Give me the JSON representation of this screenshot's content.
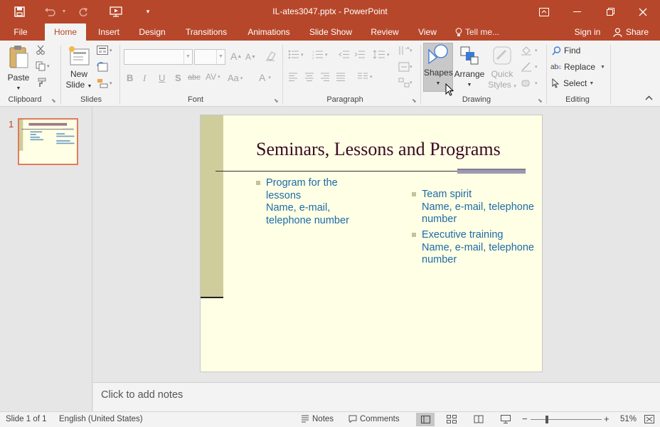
{
  "window": {
    "title": "IL-ates3047.pptx - PowerPoint"
  },
  "ribbon_tabs": [
    "File",
    "Home",
    "Insert",
    "Design",
    "Transitions",
    "Animations",
    "Slide Show",
    "Review",
    "View"
  ],
  "tell_me": "Tell me...",
  "sign_in": "Sign in",
  "share": "Share",
  "clipboard": {
    "paste": "Paste",
    "label": "Clipboard"
  },
  "slides_group": {
    "new_slide_line1": "New",
    "new_slide_line2": "Slide",
    "label": "Slides"
  },
  "font_group": {
    "label": "Font",
    "bold": "B",
    "italic": "I",
    "underline": "U",
    "shadow": "S",
    "strike": "abc",
    "case": "Aa",
    "grow": "A",
    "shrink": "A",
    "color": "A"
  },
  "paragraph_group": {
    "label": "Paragraph"
  },
  "drawing_group": {
    "label": "Drawing",
    "shapes": "Shapes",
    "arrange": "Arrange",
    "quick_styles_line1": "Quick",
    "quick_styles_line2": "Styles"
  },
  "editing_group": {
    "label": "Editing",
    "find": "Find",
    "replace": "Replace",
    "select": "Select"
  },
  "thumbnail": {
    "number": "1"
  },
  "slide": {
    "title": "Seminars, Lessons and Programs",
    "left_bullet": {
      "line1": "Program for the",
      "line2": "lessons",
      "line3": "Name, e-mail,",
      "line4": "telephone number"
    },
    "right_bullets": [
      {
        "line1": "Team spirit",
        "line2": "Name, e-mail, telephone",
        "line3": "number"
      },
      {
        "line1": "Executive training",
        "line2": "Name, e-mail, telephone",
        "line3": "number"
      }
    ]
  },
  "notes_placeholder": "Click to add notes",
  "status": {
    "slide_info": "Slide 1 of 1",
    "language": "English (United States)",
    "notes": "Notes",
    "comments": "Comments",
    "zoom": "51%"
  },
  "colors": {
    "accent": "#b7472a",
    "slide_bg": "#ffffe5",
    "title_color": "#3a0a24",
    "bullet_text": "#1c6aa8"
  }
}
